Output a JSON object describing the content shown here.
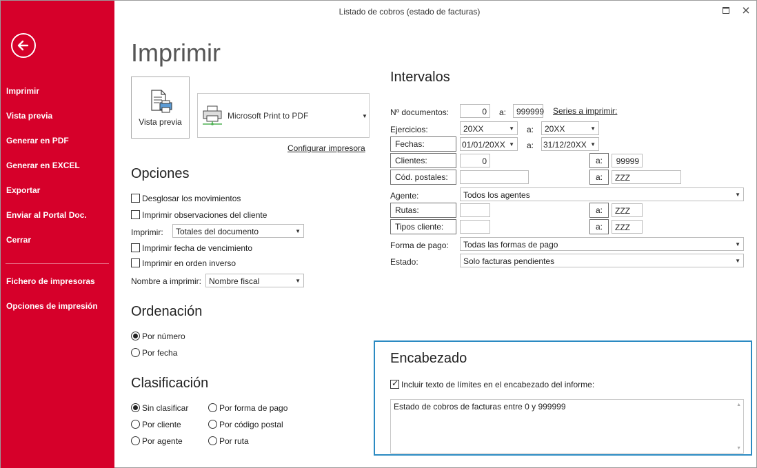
{
  "window": {
    "title": "Listado de cobros (estado de facturas)",
    "maximize_icon": "maximize-icon",
    "close_icon": "close-icon"
  },
  "sidebar": {
    "bg_color": "#d6002a",
    "items": [
      {
        "label": "Imprimir"
      },
      {
        "label": "Vista previa"
      },
      {
        "label": "Generar en PDF"
      },
      {
        "label": "Generar en EXCEL"
      },
      {
        "label": "Exportar"
      },
      {
        "label": "Enviar al Portal Doc."
      },
      {
        "label": "Cerrar"
      }
    ],
    "bottom_items": [
      {
        "label": "Fichero de impresoras"
      },
      {
        "label": "Opciones de impresión"
      }
    ]
  },
  "main": {
    "title": "Imprimir",
    "preview_label": "Vista previa",
    "printer": "Microsoft Print to PDF",
    "configure_link": "Configurar impresora"
  },
  "opciones": {
    "heading": "Opciones",
    "desglosar": "Desglosar los movimientos",
    "observaciones": "Imprimir observaciones del cliente",
    "imprimir_label": "Imprimir:",
    "imprimir_value": "Totales del documento",
    "fecha_venc": "Imprimir fecha de vencimiento",
    "orden_inverso": "Imprimir en orden inverso",
    "nombre_label": "Nombre a imprimir:",
    "nombre_value": "Nombre fiscal"
  },
  "ordenacion": {
    "heading": "Ordenación",
    "por_numero": "Por número",
    "por_fecha": "Por fecha"
  },
  "clasificacion": {
    "heading": "Clasificación",
    "sin_clasificar": "Sin clasificar",
    "por_cliente": "Por cliente",
    "por_agente": "Por agente",
    "por_forma_pago": "Por forma de pago",
    "por_codigo_postal": "Por código postal",
    "por_ruta": "Por ruta"
  },
  "intervalos": {
    "heading": "Intervalos",
    "a": "a:",
    "n_documentos_label": "Nº documentos:",
    "doc_from": "0",
    "doc_to": "999999",
    "series_link": "Series a imprimir:",
    "ejercicios_label": "Ejercicios:",
    "ejercicio_from": "20XX",
    "ejercicio_to": "20XX",
    "fechas_label": "Fechas:",
    "fecha_from": "01/01/20XX",
    "fecha_to": "31/12/20XX",
    "clientes_label": "Clientes:",
    "cliente_from": "0",
    "cliente_to": "99999",
    "cod_postales_label": "Cód. postales:",
    "cp_from": "",
    "cp_to": "ZZZ",
    "agente_label": "Agente:",
    "agente_value": "Todos los agentes",
    "rutas_label": "Rutas:",
    "ruta_from": "",
    "ruta_to": "ZZZ",
    "tipos_label": "Tipos cliente:",
    "tipo_from": "",
    "tipo_to": "ZZZ",
    "forma_pago_label": "Forma de pago:",
    "forma_pago_value": "Todas las formas de pago",
    "estado_label": "Estado:",
    "estado_value": "Solo facturas pendientes"
  },
  "encabezado": {
    "heading": "Encabezado",
    "incluir": "Incluir texto de límites en el encabezado del informe:",
    "texto": "Estado de cobros de facturas entre 0 y 999999",
    "accent_color": "#2b8ac2"
  }
}
